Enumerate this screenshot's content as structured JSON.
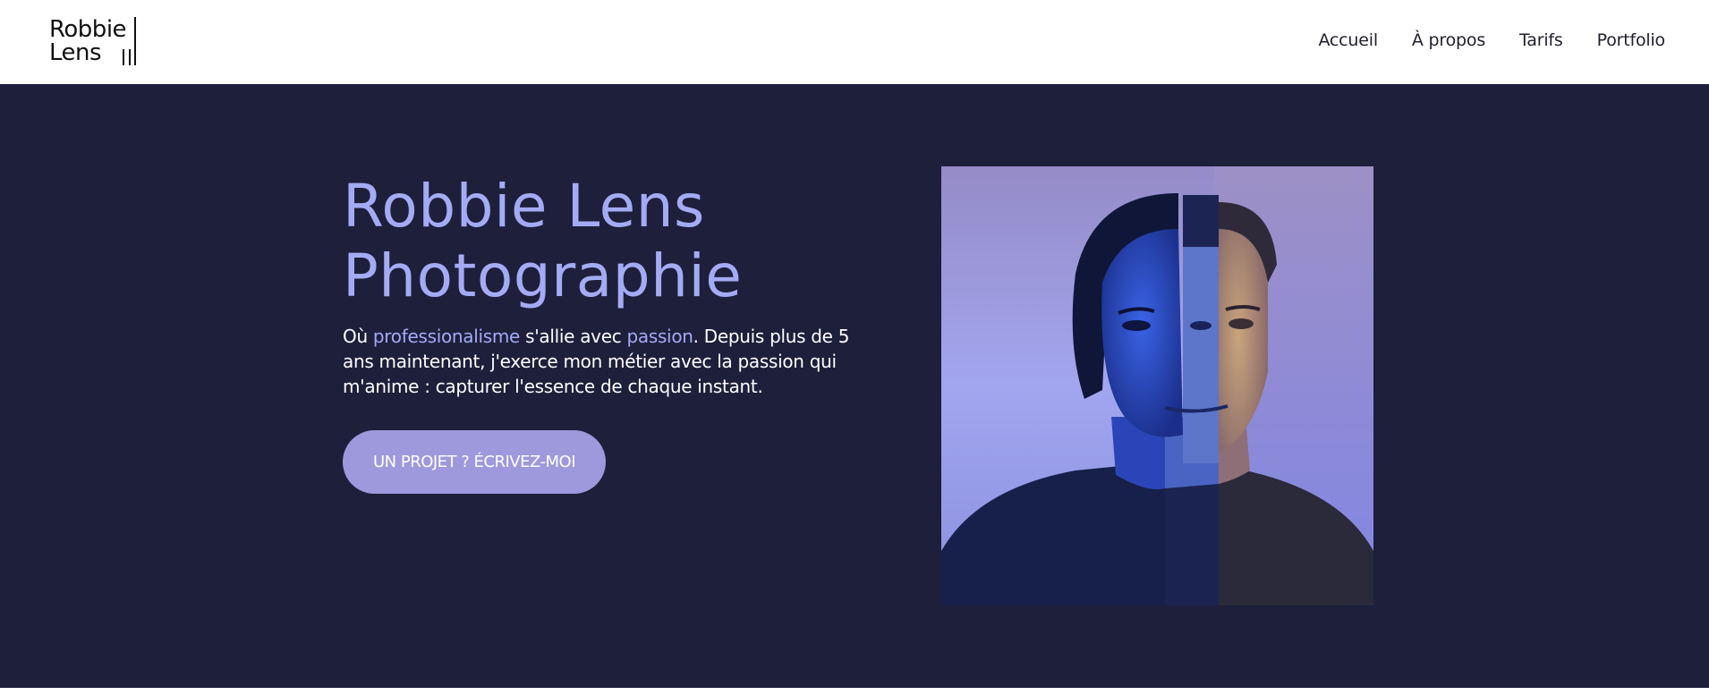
{
  "header": {
    "logo": {
      "line1": "Robbie",
      "line2": "Lens"
    },
    "nav": [
      {
        "label": "Accueil"
      },
      {
        "label": "À propos"
      },
      {
        "label": "Tarifs"
      },
      {
        "label": "Portfolio"
      }
    ]
  },
  "hero": {
    "title_line1": "Robbie Lens",
    "title_line2": "Photographie",
    "text": {
      "part1": "Où ",
      "accent1": "professionalisme",
      "part2": " s'allie avec ",
      "accent2": "passion",
      "part3": ". Depuis plus de 5 ans maintenant, j'exerce mon métier avec la passion qui m'anime : capturer l'essence de chaque instant."
    },
    "cta_label": "UN PROJET ? ÉCRIVEZ-MOI",
    "image_subject": "split-portrait-photo"
  },
  "colors": {
    "header_bg": "#ffffff",
    "hero_bg": "#1e1f3b",
    "accent": "#a4abf5",
    "button": "#9e98dd",
    "nav_text": "#1f1f2e"
  }
}
